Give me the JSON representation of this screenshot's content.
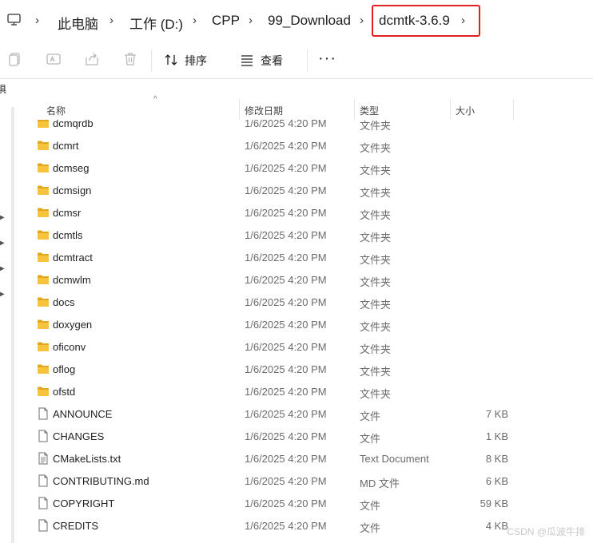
{
  "breadcrumb": {
    "items": [
      "此电脑",
      "工作 (D:)",
      "CPP",
      "99_Download",
      "dcmtk-3.6.9"
    ]
  },
  "toolbar": {
    "sort_label": "排序",
    "view_label": "查看",
    "more_label": "···"
  },
  "strip_label": "俱",
  "columns": {
    "name": "名称",
    "date": "修改日期",
    "type": "类型",
    "size": "大小"
  },
  "files": [
    {
      "name": "dcmqrdb",
      "date": "1/6/2025 4:20 PM",
      "type": "文件夹",
      "size": "",
      "kind": "folder"
    },
    {
      "name": "dcmrt",
      "date": "1/6/2025 4:20 PM",
      "type": "文件夹",
      "size": "",
      "kind": "folder"
    },
    {
      "name": "dcmseg",
      "date": "1/6/2025 4:20 PM",
      "type": "文件夹",
      "size": "",
      "kind": "folder"
    },
    {
      "name": "dcmsign",
      "date": "1/6/2025 4:20 PM",
      "type": "文件夹",
      "size": "",
      "kind": "folder"
    },
    {
      "name": "dcmsr",
      "date": "1/6/2025 4:20 PM",
      "type": "文件夹",
      "size": "",
      "kind": "folder"
    },
    {
      "name": "dcmtls",
      "date": "1/6/2025 4:20 PM",
      "type": "文件夹",
      "size": "",
      "kind": "folder"
    },
    {
      "name": "dcmtract",
      "date": "1/6/2025 4:20 PM",
      "type": "文件夹",
      "size": "",
      "kind": "folder"
    },
    {
      "name": "dcmwlm",
      "date": "1/6/2025 4:20 PM",
      "type": "文件夹",
      "size": "",
      "kind": "folder"
    },
    {
      "name": "docs",
      "date": "1/6/2025 4:20 PM",
      "type": "文件夹",
      "size": "",
      "kind": "folder"
    },
    {
      "name": "doxygen",
      "date": "1/6/2025 4:20 PM",
      "type": "文件夹",
      "size": "",
      "kind": "folder"
    },
    {
      "name": "oficonv",
      "date": "1/6/2025 4:20 PM",
      "type": "文件夹",
      "size": "",
      "kind": "folder"
    },
    {
      "name": "oflog",
      "date": "1/6/2025 4:20 PM",
      "type": "文件夹",
      "size": "",
      "kind": "folder"
    },
    {
      "name": "ofstd",
      "date": "1/6/2025 4:20 PM",
      "type": "文件夹",
      "size": "",
      "kind": "folder"
    },
    {
      "name": "ANNOUNCE",
      "date": "1/6/2025 4:20 PM",
      "type": "文件",
      "size": "7 KB",
      "kind": "file"
    },
    {
      "name": "CHANGES",
      "date": "1/6/2025 4:20 PM",
      "type": "文件",
      "size": "1 KB",
      "kind": "file"
    },
    {
      "name": "CMakeLists.txt",
      "date": "1/6/2025 4:20 PM",
      "type": "Text Document",
      "size": "8 KB",
      "kind": "text"
    },
    {
      "name": "CONTRIBUTING.md",
      "date": "1/6/2025 4:20 PM",
      "type": "MD 文件",
      "size": "6 KB",
      "kind": "file"
    },
    {
      "name": "COPYRIGHT",
      "date": "1/6/2025 4:20 PM",
      "type": "文件",
      "size": "59 KB",
      "kind": "file"
    },
    {
      "name": "CREDITS",
      "date": "1/6/2025 4:20 PM",
      "type": "文件",
      "size": "4 KB",
      "kind": "file"
    }
  ],
  "watermark": "CSDN @瓜波牛排",
  "colors": {
    "highlight": "#e02020",
    "folder": "#f7c23c",
    "folder_dark": "#e0a820"
  }
}
